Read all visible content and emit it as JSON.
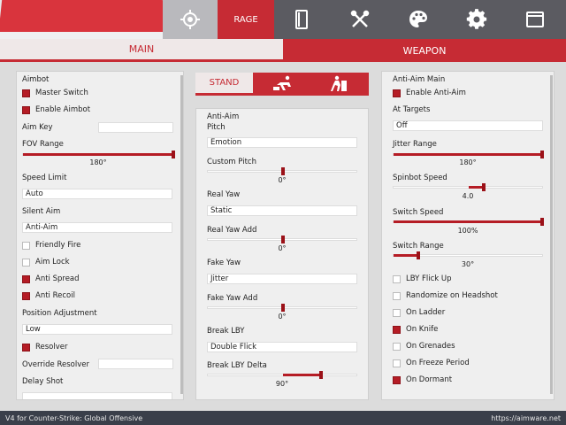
{
  "header": {
    "tabs": [
      {
        "name": "crosshair",
        "label": ""
      },
      {
        "name": "rage",
        "label": "RAGE"
      },
      {
        "name": "visuals",
        "label": ""
      },
      {
        "name": "misc",
        "label": ""
      },
      {
        "name": "skins",
        "label": ""
      },
      {
        "name": "settings",
        "label": ""
      },
      {
        "name": "window",
        "label": ""
      }
    ],
    "active_tab": "RAGE"
  },
  "subtabs": {
    "main": "MAIN",
    "weapon": "WEAPON"
  },
  "aimbot": {
    "title": "Aimbot",
    "master_switch": "Master Switch",
    "enable_aimbot": "Enable Aimbot",
    "aim_key_label": "Aim Key",
    "fov_label": "FOV Range",
    "fov_value": "180°",
    "speed_limit_label": "Speed Limit",
    "speed_limit_value": "Auto",
    "silent_aim_label": "Silent Aim",
    "silent_aim_value": "Anti-Aim",
    "friendly_fire": "Friendly Fire",
    "aim_lock": "Aim Lock",
    "anti_spread": "Anti Spread",
    "anti_recoil": "Anti Recoil",
    "position_adjust_label": "Position Adjustment",
    "position_adjust_value": "Low",
    "resolver": "Resolver",
    "override_resolver": "Override Resolver",
    "delay_shot": "Delay Shot"
  },
  "antiaim_center": {
    "tabs": {
      "stand": "STAND"
    },
    "title": "Anti-Aim",
    "pitch_label": "Pitch",
    "pitch_value": "Emotion",
    "custom_pitch_label": "Custom Pitch",
    "custom_pitch_value": "0°",
    "real_yaw_label": "Real Yaw",
    "real_yaw_value": "Static",
    "real_yaw_add_label": "Real Yaw Add",
    "real_yaw_add_value": "0°",
    "fake_yaw_label": "Fake Yaw",
    "fake_yaw_value": "Jitter",
    "fake_yaw_add_label": "Fake Yaw Add",
    "fake_yaw_add_value": "0°",
    "break_lby_label": "Break LBY",
    "break_lby_value": "Double Flick",
    "break_lby_delta_label": "Break LBY Delta",
    "break_lby_delta_value": "90°"
  },
  "antiaim_main": {
    "title": "Anti-Aim Main",
    "enable": "Enable Anti-Aim",
    "at_targets_label": "At Targets",
    "at_targets_value": "Off",
    "jitter_range_label": "Jitter Range",
    "jitter_range_value": "180°",
    "spinbot_speed_label": "Spinbot Speed",
    "spinbot_speed_value": "4.0",
    "switch_speed_label": "Switch Speed",
    "switch_speed_value": "100%",
    "switch_range_label": "Switch Range",
    "switch_range_value": "30°",
    "lby_flick_up": "LBY Flick Up",
    "randomize_headshot": "Randomize on Headshot",
    "on_ladder": "On Ladder",
    "on_knife": "On Knife",
    "on_grenades": "On Grenades",
    "on_freeze_period": "On Freeze Period",
    "on_dormant": "On Dormant"
  },
  "footer": {
    "left": "V4 for Counter-Strike: Global Offensive",
    "right": "https://aimware.net"
  },
  "colors": {
    "accent": "#c62b34",
    "checkbox_on": "#b51c25"
  }
}
